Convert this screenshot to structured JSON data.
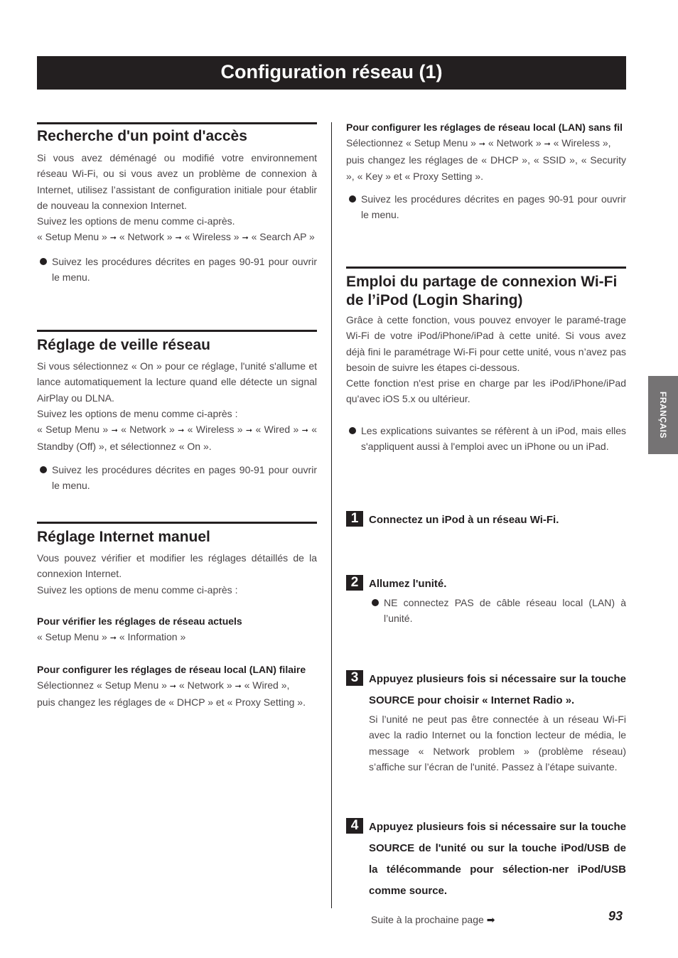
{
  "page": {
    "title": "Configuration réseau (1)",
    "language_tab": "FRANÇAIS",
    "page_number": "93",
    "continued": "Suite à la prochaine page"
  },
  "left": {
    "s1": {
      "heading": "Recherche d'un point d'accès",
      "para1": "Si vous avez déménagé ou modifié votre environnement réseau Wi-Fi, ou si vous avez un problème de connexion à Internet, utilisez l’assistant de configuration initiale pour établir de nouveau la connexion Internet.",
      "para2": "Suivez les options de menu comme ci-après.",
      "path": [
        "« Setup Menu »",
        "« Network »",
        "« Wireless »",
        "« Search AP »"
      ],
      "bullet": "Suivez les procédures décrites en pages 90-91 pour ouvrir le menu."
    },
    "s2": {
      "heading": "Réglage de veille réseau",
      "para1": "Si vous sélectionnez « On » pour ce réglage, l'unité s'allume et lance automatiquement la lecture quand elle détecte un signal AirPlay ou DLNA.",
      "para2": "Suivez les options de menu comme ci-après :",
      "path": [
        "« Setup Menu »",
        "« Network »",
        "« Wireless »",
        "« Wired »",
        "« Standby (Off) », et sélectionnez « On »."
      ],
      "bullet": "Suivez les procédures décrites en pages 90-91 pour ouvrir le menu."
    },
    "s3": {
      "heading": "Réglage Internet manuel",
      "para1": "Vous pouvez vérifier et modifier les réglages détaillés de la connexion Internet.",
      "para2": "Suivez les options de menu comme ci-après :",
      "sub1": "Pour vérifier les réglages de réseau actuels",
      "sub1_path": [
        "« Setup Menu »",
        "« Information »"
      ],
      "sub2": "Pour configurer les réglages de réseau local (LAN) filaire",
      "sub2_path_prefix": "Sélectionnez « Setup Menu »",
      "sub2_path": [
        "« Network »",
        "« Wired »,"
      ],
      "sub2_text": "puis changez les réglages de « DHCP » et « Proxy Setting »."
    }
  },
  "right": {
    "wireless": {
      "sub": "Pour configurer les réglages de réseau local (LAN) sans fil",
      "path_prefix": "Sélectionnez « Setup Menu »",
      "path": [
        "« Network »",
        "« Wireless »,"
      ],
      "text": "puis changez les réglages de « DHCP », « SSID », « Security », « Key » et « Proxy Setting ».",
      "bullet": "Suivez les procédures décrites en pages 90-91 pour ouvrir le menu."
    },
    "s4": {
      "heading": "Emploi du partage de connexion Wi-Fi de l’iPod (Login Sharing)",
      "para1": "Grâce à cette fonction, vous pouvez envoyer le paramé-trage Wi-Fi de votre iPod/iPhone/iPad à cette unité. Si vous avez déjà fini le paramétrage Wi-Fi pour cette unité, vous n’avez pas besoin de suivre les étapes ci-dessous.",
      "para2": "Cette fonction n'est prise en charge par les iPod/iPhone/iPad qu'avec iOS 5.x ou ultérieur.",
      "bullet": "Les explications suivantes se réfèrent à un iPod, mais elles s'appliquent aussi à l'emploi avec un iPhone ou un iPad."
    },
    "steps": [
      {
        "num": "1",
        "title": "Connectez un iPod à un réseau Wi-Fi."
      },
      {
        "num": "2",
        "title": "Allumez l'unité.",
        "bullet": "NE connectez PAS de câble réseau local (LAN) à l’unité."
      },
      {
        "num": "3",
        "title": "Appuyez plusieurs fois si nécessaire sur la touche SOURCE pour choisir « Internet Radio ».",
        "body": "Si l’unité ne peut pas être connectée à un réseau Wi-Fi avec la radio Internet ou la fonction lecteur de média, le message « Network problem » (problème réseau) s’affiche sur l’écran de l'unité. Passez à l’étape suivante."
      },
      {
        "num": "4",
        "title": "Appuyez plusieurs fois si nécessaire sur la touche SOURCE de l'unité ou sur la touche iPod/USB de la télécommande pour sélection-ner iPod/USB comme source."
      }
    ]
  },
  "icons": {
    "arrow": "➞",
    "next_arrow": "➡"
  }
}
